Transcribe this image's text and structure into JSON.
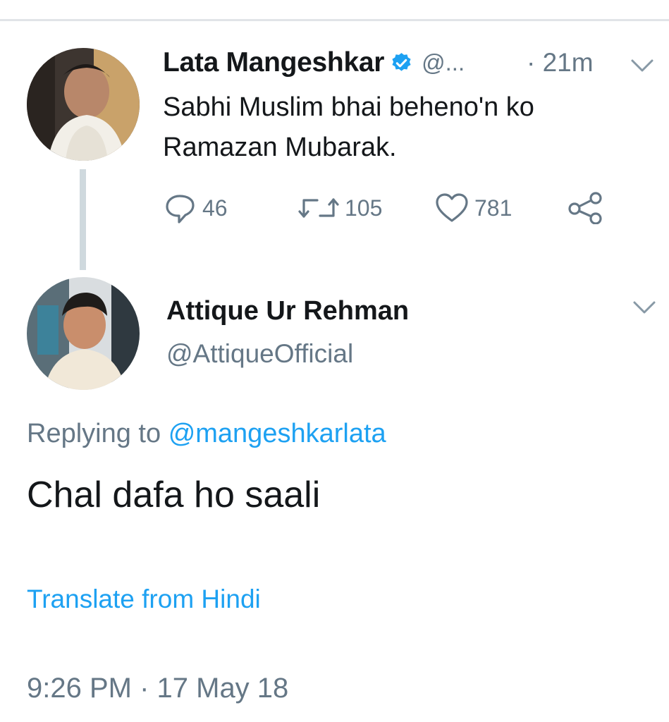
{
  "colors": {
    "accent": "#1da1f2",
    "secondary_text": "#657786",
    "primary_text": "#14171a",
    "thread_line": "#cfd9de",
    "verified_badge": "#1da1f2"
  },
  "tweet_parent": {
    "display_name": "Lata Mangeshkar",
    "verified_icon": "verified-badge-icon",
    "handle_truncated": "@...",
    "time_ago": "· 21m",
    "text": "Sabhi Muslim bhai beheno'n ko Ramazan Mubarak.",
    "replies": "46",
    "retweets": "105",
    "likes": "781",
    "icons": {
      "reply": "reply-icon",
      "retweet": "retweet-icon",
      "like": "heart-icon",
      "share": "share-icon",
      "menu": "chevron-down-icon"
    }
  },
  "tweet_reply": {
    "display_name": "Attique Ur Rehman",
    "handle": "@AttiqueOfficial",
    "replying_prefix": "Replying to",
    "replying_to": "@mangeshkarlata",
    "text": "Chal dafa ho saali",
    "translate_link": "Translate from Hindi",
    "timestamp": "9:26 PM · 17 May 18"
  }
}
